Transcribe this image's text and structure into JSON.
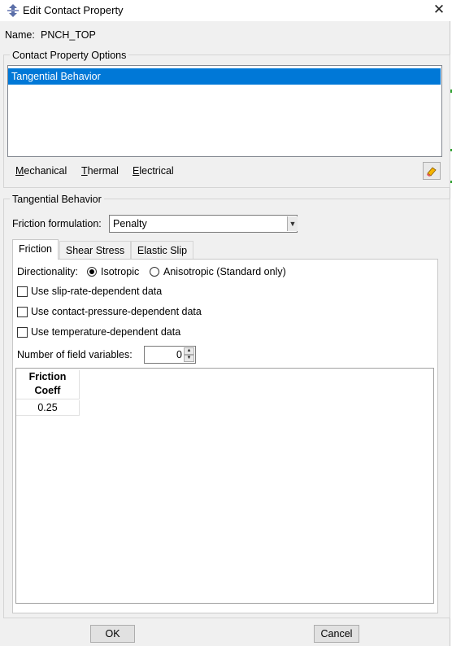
{
  "window": {
    "title": "Edit Contact Property",
    "close_label": "✕",
    "icon": "abaqus-arrows-icon"
  },
  "name": {
    "label": "Name:",
    "value": "PNCH_TOP"
  },
  "options": {
    "legend": "Contact Property Options",
    "items": [
      "Tangential Behavior"
    ],
    "selected": "Tangential Behavior",
    "menu": [
      {
        "underline": "M",
        "rest": "echanical"
      },
      {
        "underline": "T",
        "rest": "hermal"
      },
      {
        "underline": "E",
        "rest": "lectrical"
      }
    ],
    "delete_icon": "eraser-icon"
  },
  "behavior": {
    "legend": "Tangential Behavior",
    "formulation_label": "Friction formulation:",
    "formulation_value": "Penalty",
    "tabs": [
      "Friction",
      "Shear Stress",
      "Elastic Slip"
    ],
    "active_tab": "Friction"
  },
  "friction": {
    "directionality_label": "Directionality:",
    "isotropic": "Isotropic",
    "anisotropic": "Anisotropic (Standard only)",
    "selected_direction": "Isotropic",
    "checks": [
      {
        "label": "Use slip-rate-dependent data",
        "checked": false
      },
      {
        "label": "Use contact-pressure-dependent data",
        "checked": false
      },
      {
        "label": "Use temperature-dependent data",
        "checked": false
      }
    ],
    "field_vars_label": "Number of field variables:",
    "field_vars_value": "0",
    "table": {
      "header_line1": "Friction",
      "header_line2": "Coeff",
      "rows": [
        "0.25"
      ]
    }
  },
  "buttons": {
    "ok": "OK",
    "cancel": "Cancel"
  }
}
